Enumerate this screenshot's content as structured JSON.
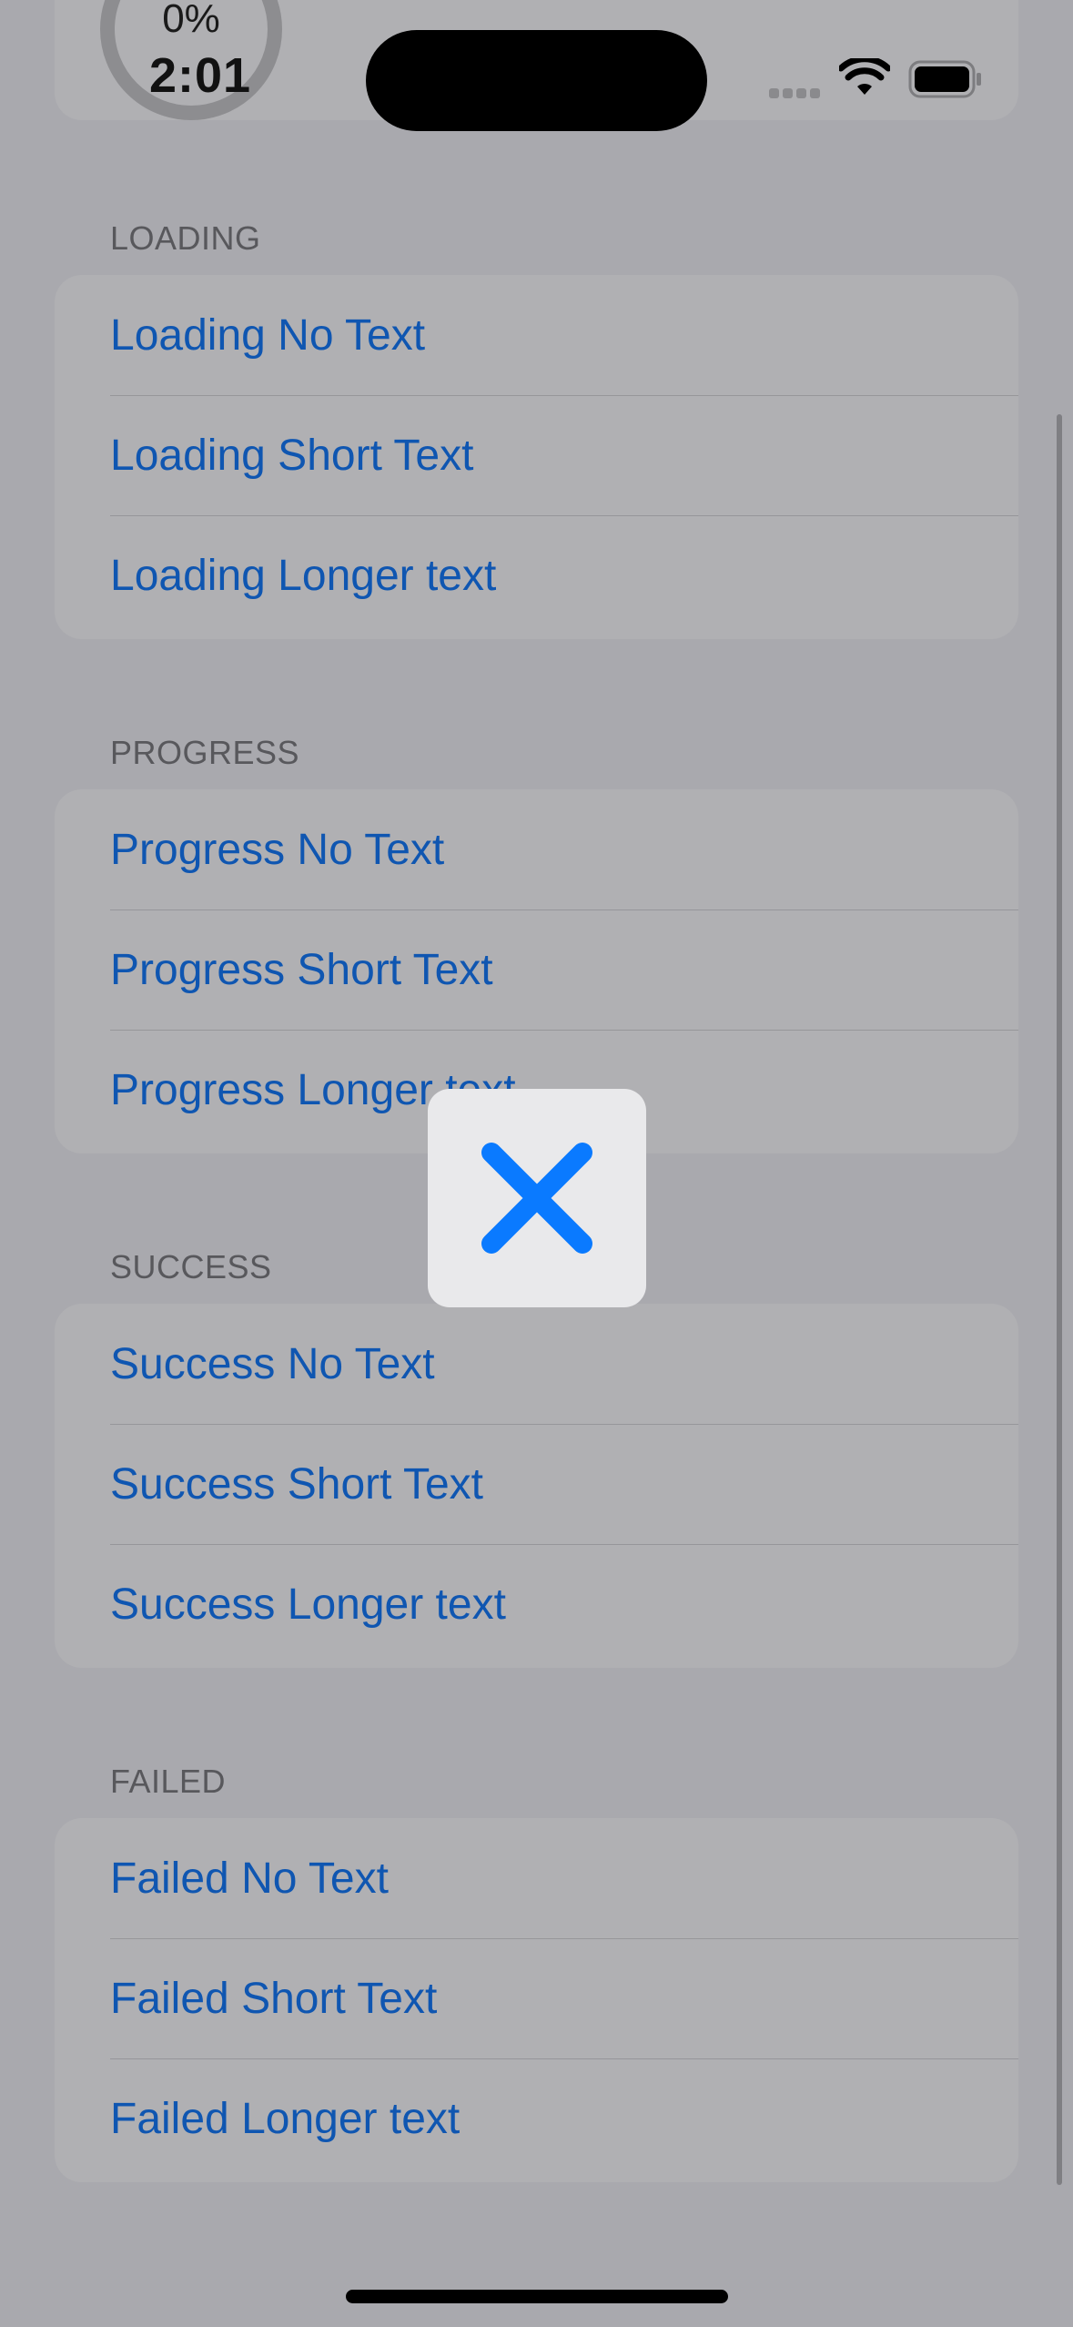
{
  "status_bar": {
    "time": "2:01",
    "progress_percent": "0%",
    "progress_value": 0
  },
  "sections": [
    {
      "header": "LOADING",
      "items": [
        "Loading No Text",
        "Loading Short Text",
        "Loading Longer text"
      ]
    },
    {
      "header": "PROGRESS",
      "items": [
        "Progress No Text",
        "Progress Short Text",
        "Progress Longer text"
      ]
    },
    {
      "header": "SUCCESS",
      "items": [
        "Success No Text",
        "Success Short Text",
        "Success Longer text"
      ]
    },
    {
      "header": "FAILED",
      "items": [
        "Failed No Text",
        "Failed Short Text",
        "Failed Longer text"
      ]
    }
  ],
  "hud": {
    "icon": "close-icon",
    "color": "#0a7aff"
  },
  "colors": {
    "link": "#0f56b1",
    "background": "#a9a9ae",
    "cell": "#b0b0b3"
  }
}
